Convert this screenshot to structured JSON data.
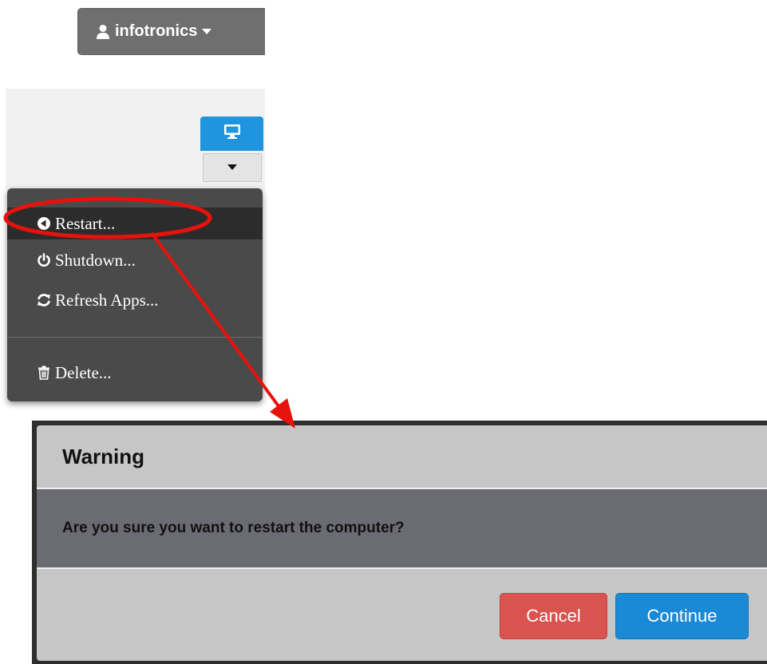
{
  "user_menu": {
    "username": "infotronics",
    "user_icon": "user-icon",
    "caret_icon": "caret-down-icon"
  },
  "device_panel": {
    "monitor_icon": "monitor-icon",
    "dropdown_icon": "caret-down-icon"
  },
  "dropdown": {
    "items": [
      {
        "label": "Restart...",
        "icon": "restart-icon",
        "active": true
      },
      {
        "label": "Shutdown...",
        "icon": "power-icon",
        "active": false
      },
      {
        "label": "Refresh Apps...",
        "icon": "refresh-icon",
        "active": false
      },
      {
        "label": "Delete...",
        "icon": "trash-icon",
        "active": false
      }
    ]
  },
  "dialog": {
    "title": "Warning",
    "message": "Are you sure you want to restart the computer?",
    "cancel_label": "Cancel",
    "continue_label": "Continue"
  },
  "colors": {
    "annotation": "#e8120c",
    "primary": "#1a8ad6",
    "danger": "#d9534f",
    "monitor_button": "#1e95de"
  }
}
